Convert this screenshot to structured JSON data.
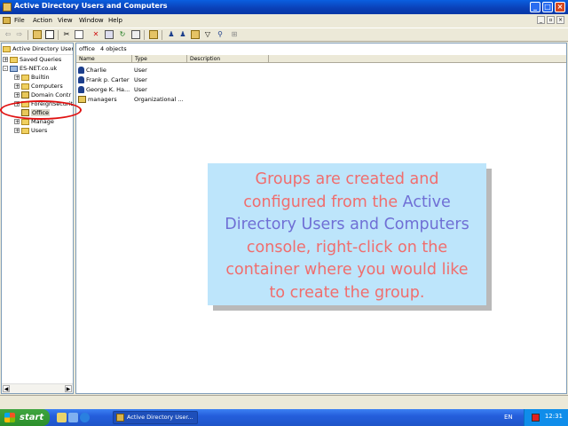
{
  "window": {
    "title": "Active Directory Users and Computers",
    "buttons": [
      "_",
      "□",
      "×"
    ]
  },
  "menu": {
    "items": [
      "File",
      "Action",
      "View",
      "Window",
      "Help"
    ]
  },
  "toolbar": {
    "buttons": [
      "back",
      "forward",
      "up",
      "show-tree",
      "cut",
      "copy",
      "delete",
      "properties",
      "refresh",
      "export",
      "help",
      "new-user",
      "new-group",
      "new-ou",
      "filter",
      "find",
      "add-to-group"
    ]
  },
  "tree": {
    "header": "Active Directory Users",
    "items": [
      {
        "label": "Saved Queries",
        "expander": "+",
        "icon": "folder"
      },
      {
        "label": "ES-NET.co.uk",
        "expander": "-",
        "icon": "domain"
      },
      {
        "label": "Builtin",
        "expander": "+",
        "icon": "folder"
      },
      {
        "label": "Computers",
        "expander": "+",
        "icon": "folder"
      },
      {
        "label": "Domain Contr",
        "expander": "+",
        "icon": "ou"
      },
      {
        "label": "ForeignSecurit",
        "expander": "+",
        "icon": "folder"
      },
      {
        "label": "Office",
        "expander": "",
        "icon": "ou",
        "selected": true
      },
      {
        "label": "Manage",
        "expander": "+",
        "icon": "folder"
      },
      {
        "label": "Users",
        "expander": "+",
        "icon": "folder"
      }
    ]
  },
  "list": {
    "title": "office",
    "count": "4 objects",
    "columns": [
      "Name",
      "Type",
      "Description"
    ],
    "rows": [
      {
        "name": "Charlie",
        "type": "User",
        "description": "",
        "icon": "user"
      },
      {
        "name": "Frank p. Carter",
        "type": "User",
        "description": "",
        "icon": "user"
      },
      {
        "name": "George K. Ha...",
        "type": "User",
        "description": "",
        "icon": "user"
      },
      {
        "name": "managers",
        "type": "Organizational ...",
        "description": "",
        "icon": "ou"
      }
    ]
  },
  "callout": {
    "line1": "Groups are created and",
    "line2a": "configured from the ",
    "line2b": "Active",
    "line3": "Directory Users and Computers",
    "line4": "console, right-click on the",
    "line5": "container where you would like",
    "line6": "to create the group."
  },
  "taskbar": {
    "start": "start",
    "task_item": "Active Directory User...",
    "language": "EN",
    "clock": "12:31"
  },
  "colors": {
    "callout_bg": "#bde5fb",
    "callout_text": "#f06d6d",
    "callout_highlight": "#6f6fd5",
    "highlight_ring": "#e01010"
  }
}
